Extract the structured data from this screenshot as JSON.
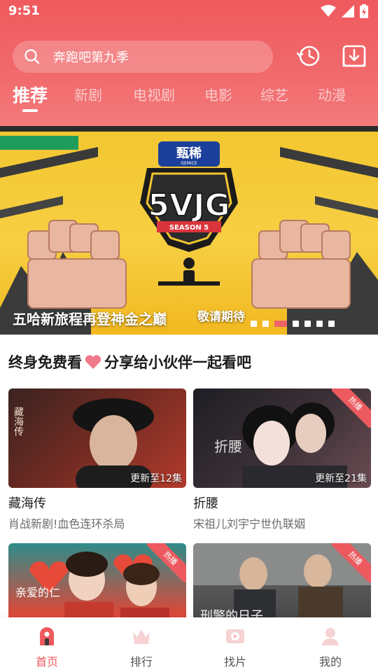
{
  "status": {
    "time": "9:51"
  },
  "search": {
    "placeholder": "奔跑吧第九季"
  },
  "tabs": [
    {
      "label": "推荐",
      "active": true
    },
    {
      "label": "新剧"
    },
    {
      "label": "电视剧"
    },
    {
      "label": "电影"
    },
    {
      "label": "综艺"
    },
    {
      "label": "动漫"
    }
  ],
  "banner": {
    "caption": "五哈新旅程再登神金之巅",
    "subcaption": "敬请期待",
    "logo_text": "5VJG",
    "season_text": "SEASON 5",
    "brand_text": "甄稀",
    "brand_sub": "GEMICE",
    "dots_count": 7,
    "active_dot": 2
  },
  "section": {
    "title_before": "终身免费看",
    "title_after": "分享给小伙伴一起看吧"
  },
  "cards": [
    {
      "title": "藏海传",
      "desc": "肖战新剧!血色连环杀局",
      "update": "更新至12集",
      "hot": false,
      "poster_text": "藏海传"
    },
    {
      "title": "折腰",
      "desc": "宋祖儿刘宇宁世仇联姻",
      "update": "更新至21集",
      "hot": true,
      "hot_label": "热播",
      "poster_text": "折腰"
    },
    {
      "title": "",
      "desc": "",
      "update": "",
      "hot": true,
      "hot_label": "热播",
      "poster_text": "亲爱的仁"
    },
    {
      "title": "",
      "desc": "",
      "update": "",
      "hot": true,
      "hot_label": "热播",
      "poster_text": "刑警的日子"
    }
  ],
  "nav": [
    {
      "label": "首页",
      "icon": "home-icon",
      "active": true
    },
    {
      "label": "排行",
      "icon": "crown-icon"
    },
    {
      "label": "找片",
      "icon": "play-icon"
    },
    {
      "label": "我的",
      "icon": "user-icon"
    }
  ],
  "colors": {
    "accent": "#ef5a5e",
    "banner_yellow": "#f3c62f"
  }
}
